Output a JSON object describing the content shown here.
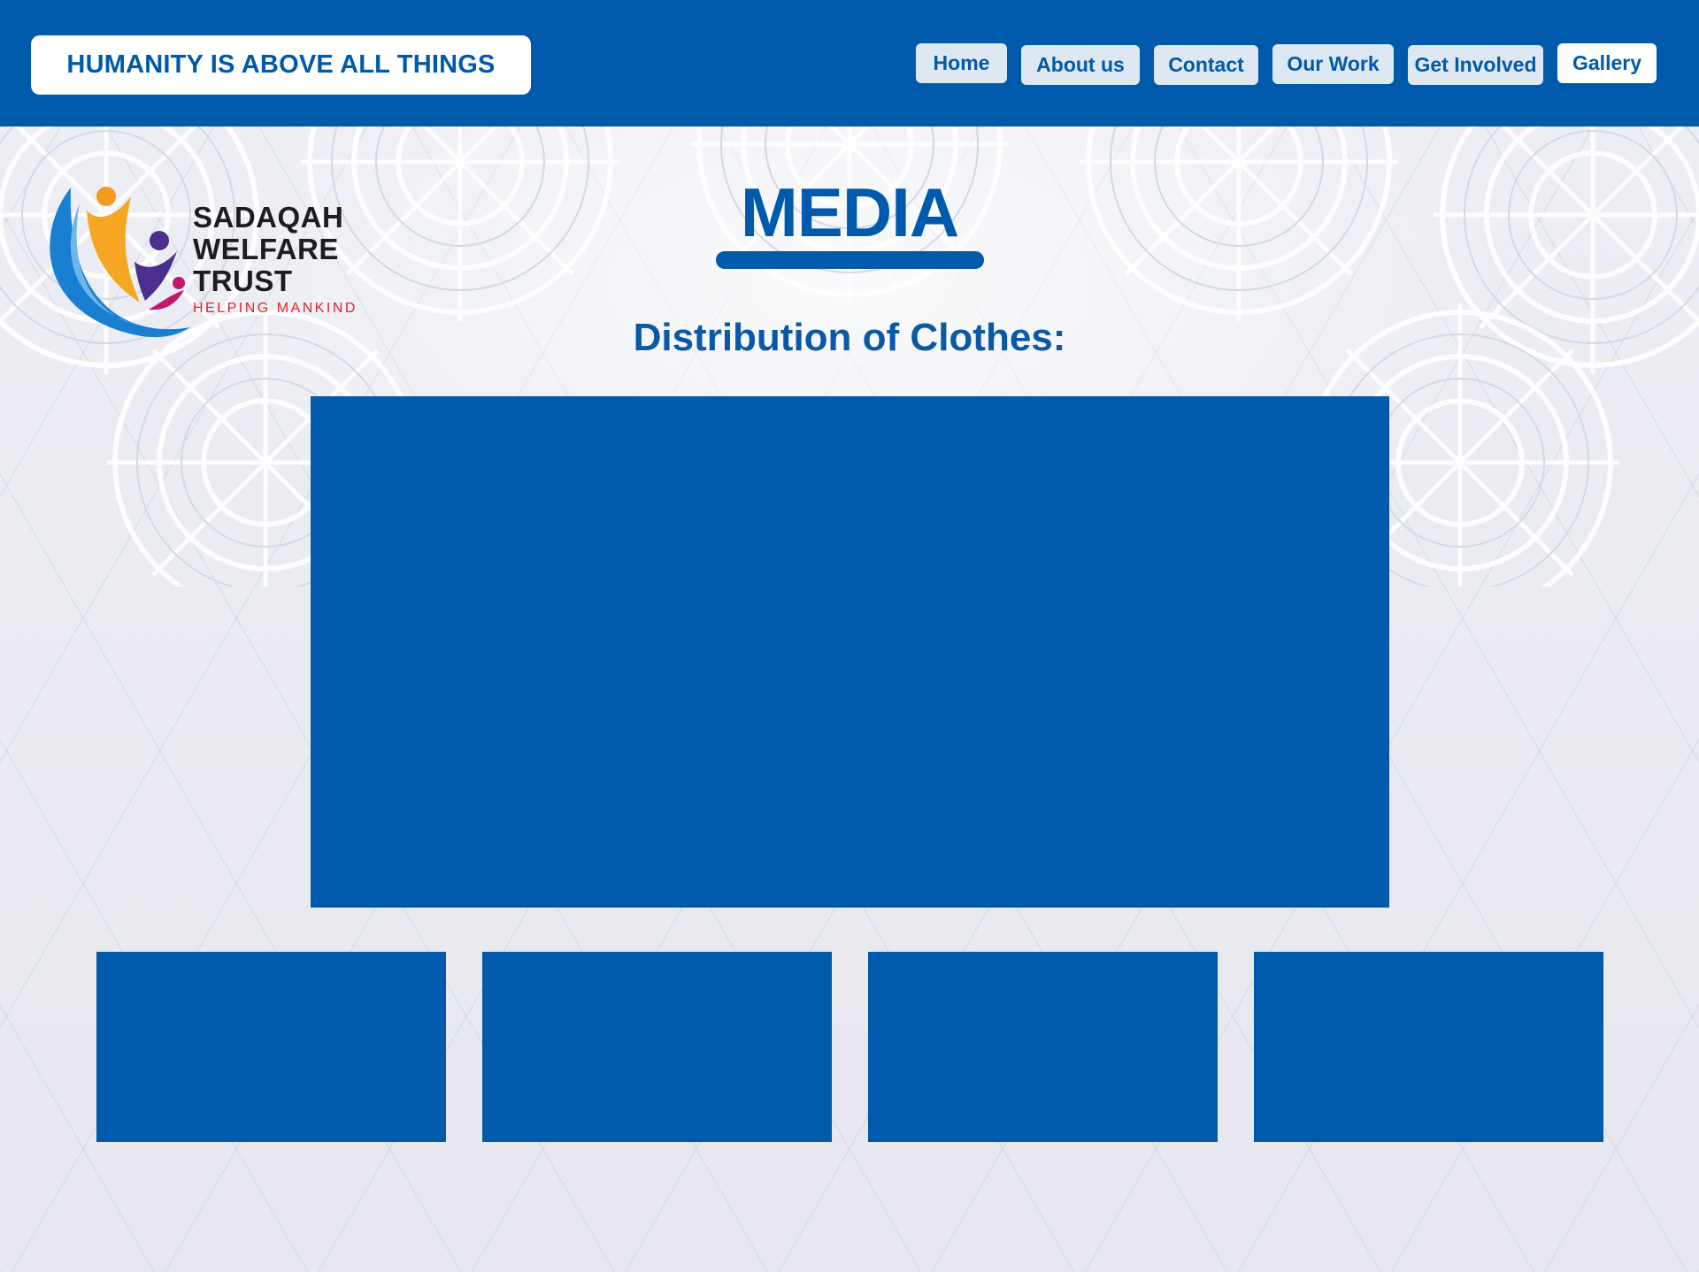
{
  "header": {
    "tagline": "HUMANITY IS ABOVE ALL THINGS",
    "nav": [
      {
        "label": "Home"
      },
      {
        "label": "About us"
      },
      {
        "label": "Contact"
      },
      {
        "label": "Our Work"
      },
      {
        "label": "Get Involved"
      },
      {
        "label": "Gallery",
        "active": true
      }
    ]
  },
  "logo": {
    "line1": "SADAQAH",
    "line2": "WELFARE",
    "line3": "TRUST",
    "subtitle": "HELPING MANKIND"
  },
  "main": {
    "title": "MEDIA",
    "section_heading": "Distribution of Clothes:",
    "gallery": {
      "featured_count": 1,
      "thumbnail_count": 4
    }
  },
  "colors": {
    "brand_blue": "#005aab",
    "nav_button_bg": "#dde8f3",
    "active_nav_bg": "#ffffff",
    "logo_accent_red": "#d8262f",
    "logo_orange": "#f39a1e",
    "logo_purple": "#4a2f8f",
    "logo_magenta": "#c2186b",
    "logo_arc_blue": "#1a7fd0"
  },
  "icons": {
    "logo_mark": "people-embrace-logo-icon"
  }
}
